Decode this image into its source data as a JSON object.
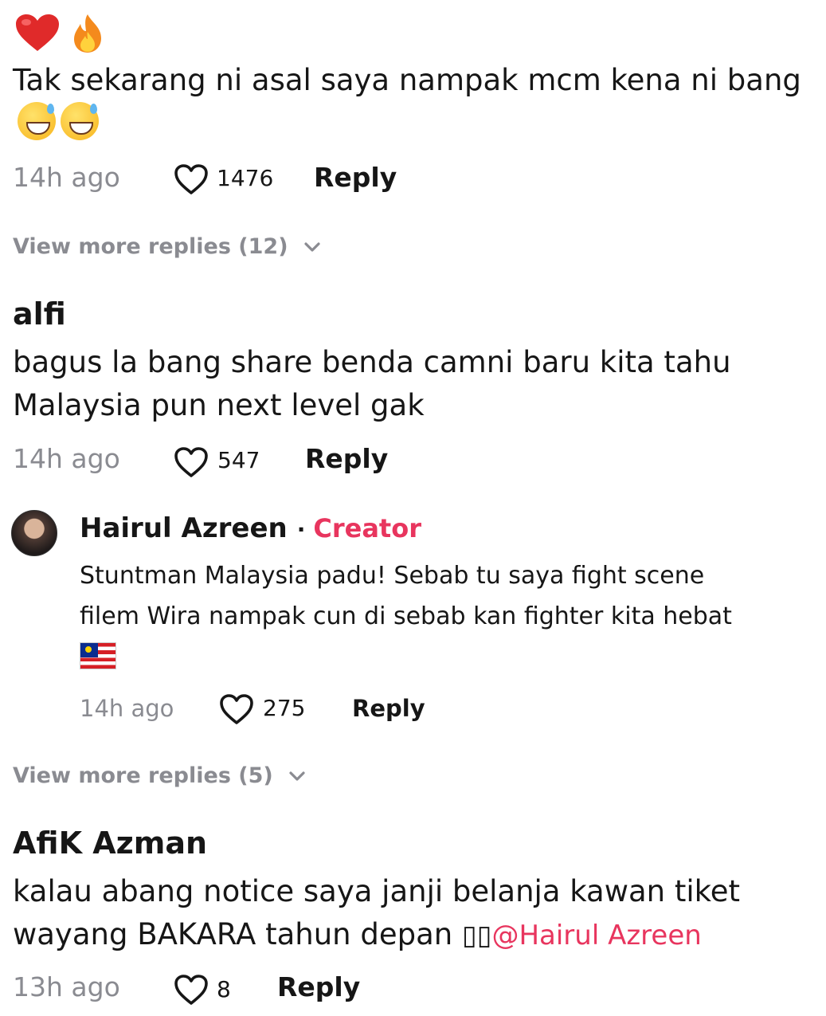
{
  "comments": [
    {
      "reactions": [
        "heart-emoji",
        "fire-emoji"
      ],
      "text": "Tak sekarang ni asal saya nampak mcm kena ni bang",
      "trailing_emoji": [
        "sweat-smile-emoji",
        "sweat-smile-emoji"
      ],
      "time": "14h ago",
      "likes": "1476",
      "reply_label": "Reply",
      "view_more": "View more replies (12)"
    },
    {
      "username": "alfi",
      "text_line1": "bagus la bang share benda camni baru kita tahu",
      "text_line2": "Malaysia pun next level gak",
      "time": "14h ago",
      "likes": "547",
      "reply_label": "Reply",
      "creator_reply": {
        "username": "Hairul Azreen",
        "dot": "·",
        "badge": "Creator",
        "text_line1": "Stuntman Malaysia padu! Sebab tu saya fight scene",
        "text_line2": "filem Wira nampak cun di sebab kan fighter kita hebat",
        "flag": "malaysia-flag-emoji",
        "time": "14h ago",
        "likes": "275",
        "reply_label": "Reply"
      },
      "view_more": "View more replies (5)"
    },
    {
      "username": "AfiK Azman",
      "text_line1": "kalau abang notice saya janji belanja kawan tiket",
      "text_line2": "wayang BAKARA tahun depan ",
      "glyphs": "▯▯",
      "mention": "@Hairul Azreen",
      "time": "13h ago",
      "likes": "8",
      "reply_label": "Reply"
    }
  ],
  "colors": {
    "mention": "#e8355e",
    "muted": "#8a8b91",
    "text": "#161616"
  }
}
